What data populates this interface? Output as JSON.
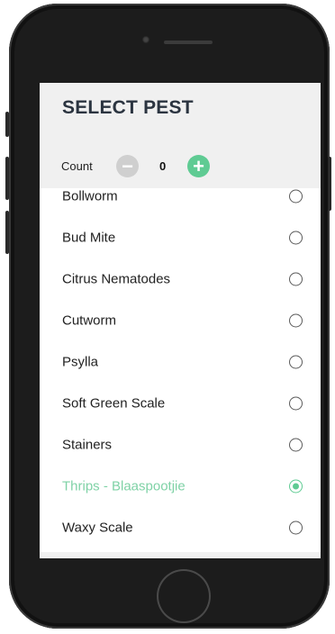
{
  "header": {
    "title": "SELECT PEST"
  },
  "counter": {
    "label": "Count",
    "value": "0",
    "minus_icon": "minus-icon",
    "plus_icon": "plus-icon"
  },
  "pests": [
    {
      "label": "Bollworm",
      "selected": false
    },
    {
      "label": "Bud Mite",
      "selected": false
    },
    {
      "label": "Citrus Nematodes",
      "selected": false
    },
    {
      "label": "Cutworm",
      "selected": false
    },
    {
      "label": "Psylla",
      "selected": false
    },
    {
      "label": "Soft Green Scale",
      "selected": false
    },
    {
      "label": "Stainers",
      "selected": false
    },
    {
      "label": "Thrips - Blaaspootjie",
      "selected": true
    },
    {
      "label": "Waxy Scale",
      "selected": false
    }
  ],
  "colors": {
    "accent": "#5fcb93",
    "selected_text": "#7fd2a6",
    "title": "#2b3440"
  }
}
